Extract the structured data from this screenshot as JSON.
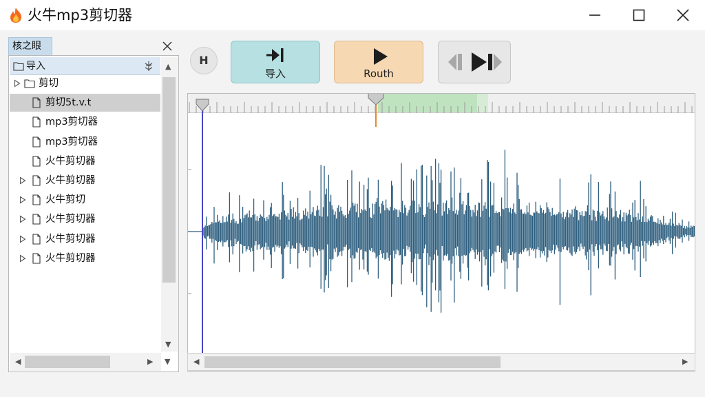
{
  "window": {
    "title": "火牛mp3剪切器",
    "icon": "flame-icon",
    "controls": [
      "minimize-icon",
      "maximize-icon",
      "close-icon"
    ]
  },
  "left_panel": {
    "tab_label": "核之眼",
    "close_icon": "close-icon",
    "header": {
      "label": "导入",
      "icon": "folder-icon",
      "action_icon": "tree-settings-icon"
    },
    "items": [
      {
        "label": "剪切",
        "type": "folder",
        "expandable": true,
        "indent": 0,
        "selected": false
      },
      {
        "label": "剪切5t.v.t",
        "type": "file",
        "expandable": false,
        "indent": 1,
        "selected": true
      },
      {
        "label": "mp3剪切器",
        "type": "file",
        "expandable": false,
        "indent": 1,
        "selected": false
      },
      {
        "label": "mp3剪切器",
        "type": "file",
        "expandable": false,
        "indent": 1,
        "selected": false
      },
      {
        "label": "火牛剪切器",
        "type": "file",
        "expandable": false,
        "indent": 1,
        "selected": false
      },
      {
        "label": "火牛剪切器",
        "type": "file",
        "expandable": true,
        "indent": 1,
        "selected": false
      },
      {
        "label": "火牛剪切",
        "type": "file",
        "expandable": true,
        "indent": 1,
        "selected": false
      },
      {
        "label": "火牛剪切器",
        "type": "file",
        "expandable": true,
        "indent": 1,
        "selected": false
      },
      {
        "label": "火牛剪切器",
        "type": "file",
        "expandable": true,
        "indent": 1,
        "selected": false
      },
      {
        "label": "火牛剪切器",
        "type": "file",
        "expandable": true,
        "indent": 1,
        "selected": false
      }
    ]
  },
  "toolbar": {
    "h_button": "H",
    "import_label": "导入",
    "import_icon": "import-icon",
    "play_label": "Routh",
    "play_icon": "play-icon",
    "seek_icon": "seek-icon"
  },
  "waveform": {
    "icons": [
      "playhead-start-marker",
      "playhead-current-marker"
    ]
  },
  "colors": {
    "waveform": "#2d5e7e",
    "selection": "#bfe3bf",
    "import_button": "#b6e0e2",
    "play_button": "#f6d8b2",
    "playhead_start": "#4a45c4",
    "playhead_current": "#e38b2c"
  }
}
